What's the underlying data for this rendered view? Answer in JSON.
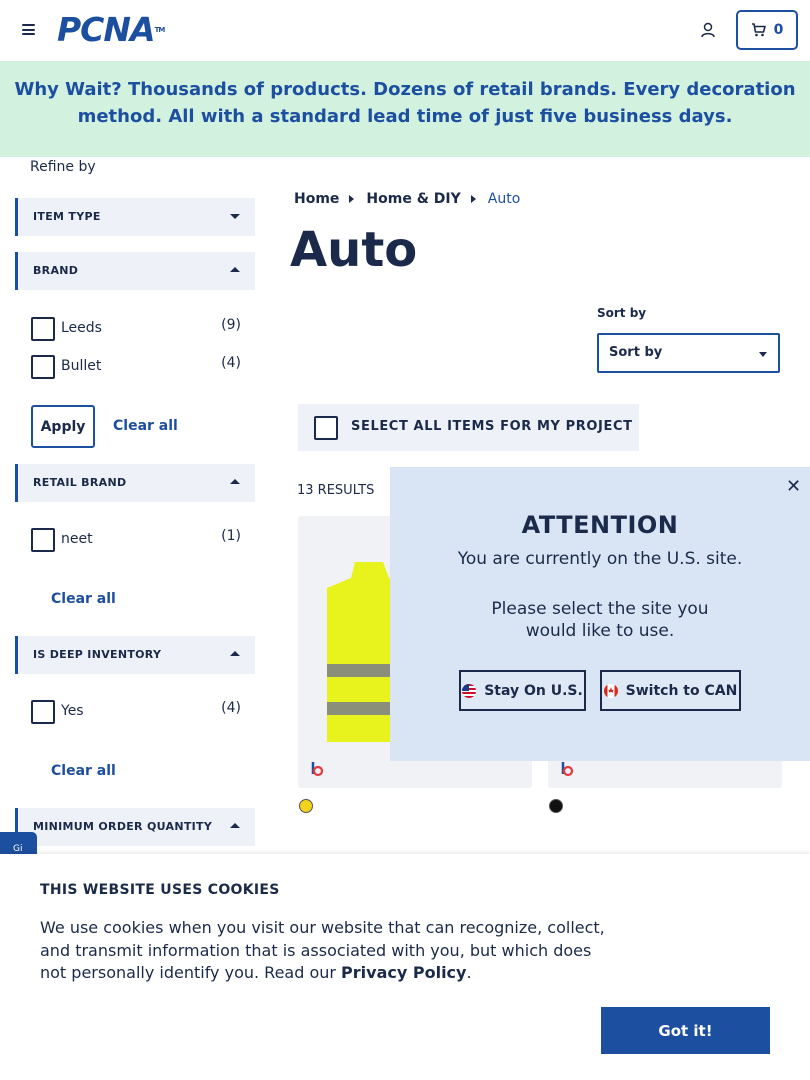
{
  "header": {
    "logo_text": "PCNA",
    "logo_tm": "TM",
    "cart_count": "0"
  },
  "banner": {
    "lead": "Why Wait?",
    "text": " Thousands of products. Dozens of retail brands. Every decoration method. All with a standard lead time of just five business days."
  },
  "sidebar": {
    "refine_label": "Refine by",
    "facets": {
      "item_type": "ITEM TYPE",
      "brand": "BRAND",
      "retail_brand": "RETAIL BRAND",
      "deep_inventory": "IS DEEP INVENTORY",
      "min_order": "MINIMUM ORDER QUANTITY"
    },
    "brand_options": [
      {
        "label": "Leeds",
        "count": "(9)"
      },
      {
        "label": "Bullet",
        "count": "(4)"
      }
    ],
    "retail_brand_options": [
      {
        "label": "neet",
        "count": "(1)"
      }
    ],
    "deep_inventory_options": [
      {
        "label": "Yes",
        "count": "(4)"
      }
    ],
    "apply_label": "Apply",
    "clear_all_label": "Clear all",
    "side_tab_label": "Gi"
  },
  "main": {
    "breadcrumb": [
      "Home",
      "Home & DIY",
      "Auto"
    ],
    "title": "Auto",
    "sort_label": "Sort by",
    "sort_value": "Sort by",
    "select_all_label": "SELECT ALL ITEMS FOR MY PROJECT",
    "results": "13 RESULTS",
    "swatch_colors": [
      "#f2d21a",
      "#111111"
    ]
  },
  "modal": {
    "title": "ATTENTION",
    "line1": "You are currently on the U.S. site.",
    "line2": "Please select the site you",
    "line3": "would like to use.",
    "stay_label": "Stay On U.S.",
    "switch_label": "Switch to CAN"
  },
  "cookie": {
    "title": "THIS WEBSITE USES COOKIES",
    "text": "We use cookies when you visit our website that can recognize, collect, and transmit information that is associated with you, but which does not personally identify you. Read our ",
    "link": "Privacy Policy",
    "end": ".",
    "button": "Got it!"
  },
  "colors": {
    "brand_blue": "#1d4fa0",
    "navy": "#1b2a4a",
    "banner_bg": "#d2f1de",
    "modal_bg": "#d9e5f5",
    "vest_yellow": "#e8f21c"
  }
}
